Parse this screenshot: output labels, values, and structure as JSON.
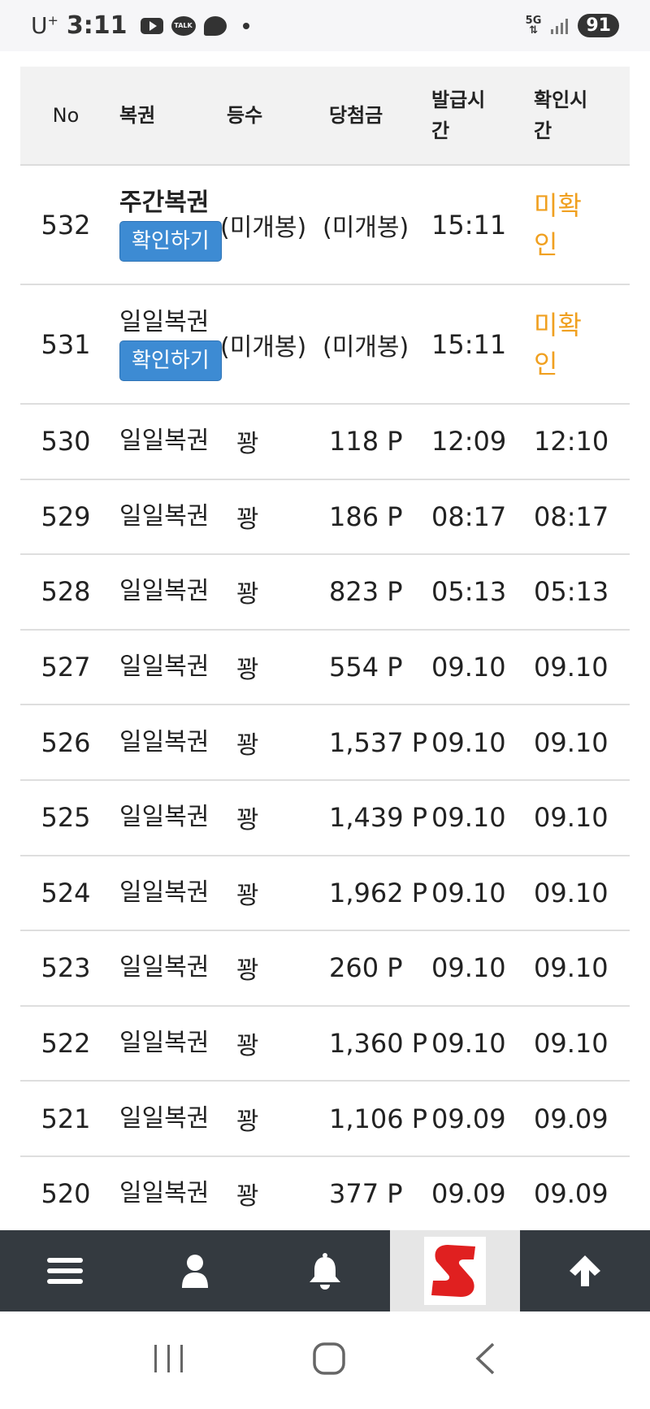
{
  "status_bar": {
    "carrier": "U",
    "carrier_sup": "+",
    "time": "3:11",
    "talk_label": "TALK",
    "network": "5G",
    "battery": "91"
  },
  "table": {
    "headers": {
      "no": "No",
      "ticket": "복권",
      "rank": "등수",
      "prize": "당첨금",
      "issued_line1": "발급시",
      "issued_line2": "간",
      "checked_line1": "확인시",
      "checked_line2": "간"
    },
    "pending_rows": [
      {
        "no": "532",
        "ticket": "주간복권",
        "button": "확인하기",
        "rank": "(미개봉)",
        "prize": "(미개봉)",
        "issued": "15:11",
        "status_line1": "미확",
        "status_line2": "인"
      },
      {
        "no": "531",
        "ticket": "일일복권",
        "button": "확인하기",
        "rank": "(미개봉)",
        "prize": "(미개봉)",
        "issued": "15:11",
        "status_line1": "미확",
        "status_line2": "인"
      }
    ],
    "rows": [
      {
        "no": "530",
        "ticket": "일일복권",
        "rank": "꽝",
        "prize": "118 P",
        "issued": "12:09",
        "checked": "12:10"
      },
      {
        "no": "529",
        "ticket": "일일복권",
        "rank": "꽝",
        "prize": "186 P",
        "issued": "08:17",
        "checked": "08:17"
      },
      {
        "no": "528",
        "ticket": "일일복권",
        "rank": "꽝",
        "prize": "823 P",
        "issued": "05:13",
        "checked": "05:13"
      },
      {
        "no": "527",
        "ticket": "일일복권",
        "rank": "꽝",
        "prize": "554 P",
        "issued": "09.10",
        "checked": "09.10"
      },
      {
        "no": "526",
        "ticket": "일일복권",
        "rank": "꽝",
        "prize": "1,537 P",
        "issued": "09.10",
        "checked": "09.10"
      },
      {
        "no": "525",
        "ticket": "일일복권",
        "rank": "꽝",
        "prize": "1,439 P",
        "issued": "09.10",
        "checked": "09.10"
      },
      {
        "no": "524",
        "ticket": "일일복권",
        "rank": "꽝",
        "prize": "1,962 P",
        "issued": "09.10",
        "checked": "09.10"
      },
      {
        "no": "523",
        "ticket": "일일복권",
        "rank": "꽝",
        "prize": "260 P",
        "issued": "09.10",
        "checked": "09.10"
      },
      {
        "no": "522",
        "ticket": "일일복권",
        "rank": "꽝",
        "prize": "1,360 P",
        "issued": "09.10",
        "checked": "09.10"
      },
      {
        "no": "521",
        "ticket": "일일복권",
        "rank": "꽝",
        "prize": "1,106 P",
        "issued": "09.09",
        "checked": "09.09"
      },
      {
        "no": "520",
        "ticket": "일일복권",
        "rank": "꽝",
        "prize": "377 P",
        "issued": "09.09",
        "checked": "09.09"
      }
    ]
  },
  "bottom_nav": {
    "items": [
      "menu-icon",
      "user-icon",
      "bell-icon",
      "logo",
      "arrow-up-icon"
    ]
  },
  "colors": {
    "pending": "#f0a020",
    "button": "#3d8bd3",
    "nav_bg": "#343a40",
    "logo_red": "#e02020"
  }
}
